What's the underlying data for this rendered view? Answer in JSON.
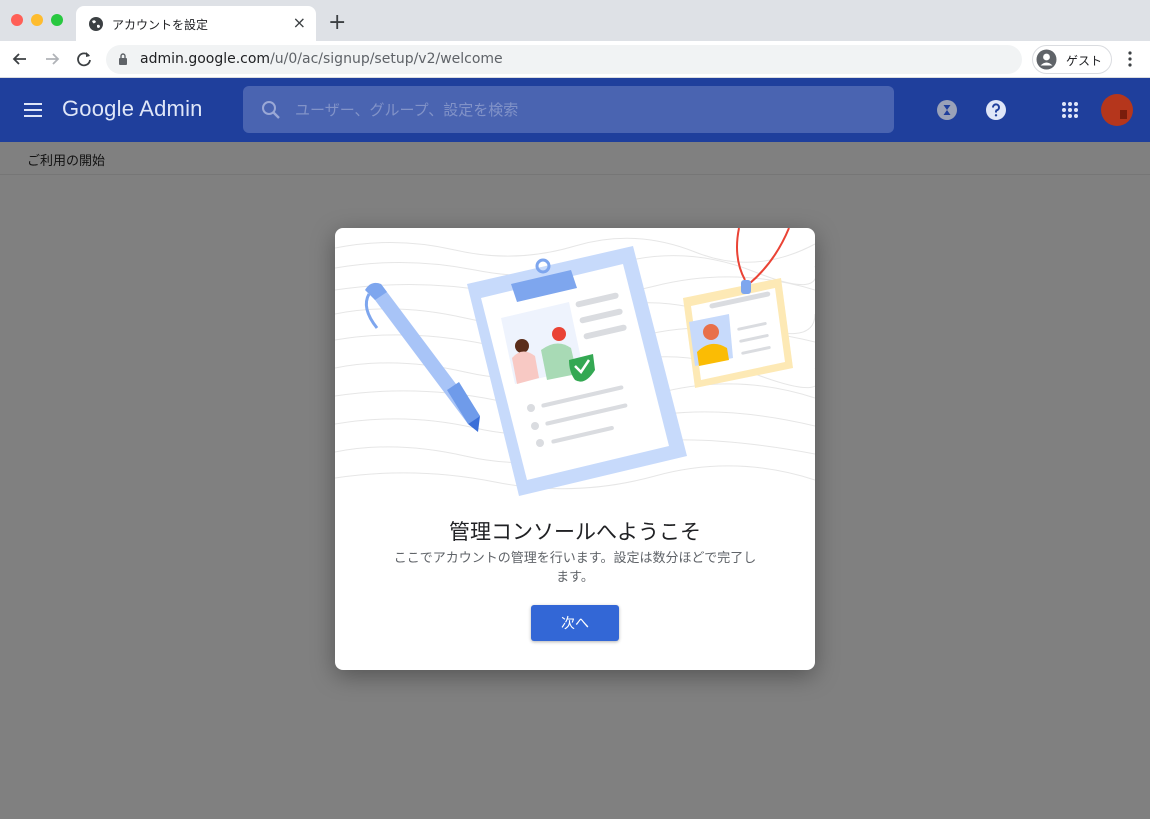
{
  "browser": {
    "tab_title": "アカウントを設定",
    "tab_close": "×",
    "new_tab": "+",
    "url_host": "admin.google.com",
    "url_path": "/u/0/ac/signup/setup/v2/welcome",
    "profile_label": "ゲスト"
  },
  "app": {
    "logo": "Google Admin",
    "search_placeholder": "ユーザー、グループ、設定を検索",
    "accent_color": "#1f3f9c",
    "header_icons": [
      "hourglass-icon",
      "help-icon",
      "apps-grid-icon",
      "avatar"
    ]
  },
  "page": {
    "breadcrumb": "ご利用の開始"
  },
  "dialog": {
    "title": "管理コンソールへようこそ",
    "body_line1": "ここでアカウントの管理を行います。設定は数分ほどで完了し",
    "body_line2": "ます。",
    "next_button": "次へ",
    "button_color": "#3367d6"
  }
}
